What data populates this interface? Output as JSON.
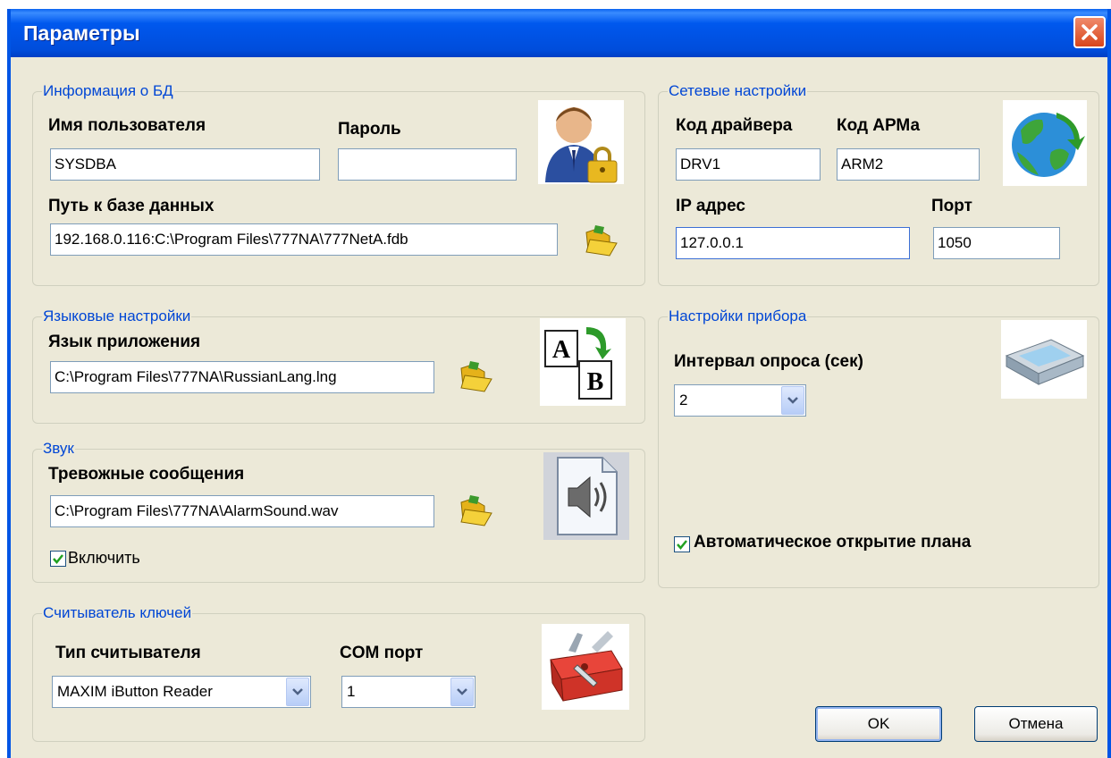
{
  "window": {
    "title": "Параметры"
  },
  "db": {
    "legend": "Информация о БД",
    "user_label": "Имя пользователя",
    "user_value": "SYSDBA",
    "password_label": "Пароль",
    "password_value": "",
    "path_label": "Путь к базе данных",
    "path_value": "192.168.0.116:C:\\Program Files\\777NA\\777NetA.fdb"
  },
  "network": {
    "legend": "Сетевые настройки",
    "driver_label": "Код драйвера",
    "driver_value": "DRV1",
    "arm_label": "Код АРМа",
    "arm_value": "ARM2",
    "ip_label": "IP адрес",
    "ip_value": "127.0.0.1",
    "port_label": "Порт",
    "port_value": "1050"
  },
  "language": {
    "legend": "Языковые настройки",
    "app_lang_label": "Язык приложения",
    "app_lang_value": "C:\\Program Files\\777NA\\RussianLang.lng"
  },
  "device": {
    "legend": "Настройки прибора",
    "interval_label": "Интервал опроса (сек)",
    "interval_value": "2",
    "auto_open_label": "Автоматическое открытие плана",
    "auto_open_checked": true
  },
  "sound": {
    "legend": "Звук",
    "alarm_label": "Тревожные сообщения",
    "alarm_value": "C:\\Program Files\\777NA\\AlarmSound.wav",
    "enable_label": "Включить",
    "enable_checked": true
  },
  "reader": {
    "legend": "Считыватель ключей",
    "type_label": "Тип считывателя",
    "type_value": "MAXIM iButton Reader",
    "com_label": "COM порт",
    "com_value": "1"
  },
  "buttons": {
    "ok": "OK",
    "cancel": "Отмена"
  },
  "icons": {
    "user_lock": "user-lock-icon",
    "globe": "globe-icon",
    "translate": "translate-icon",
    "scanner": "scanner-device-icon",
    "sound_file": "sound-file-icon",
    "toolbox": "toolbox-icon",
    "folder": "open-folder-icon"
  }
}
